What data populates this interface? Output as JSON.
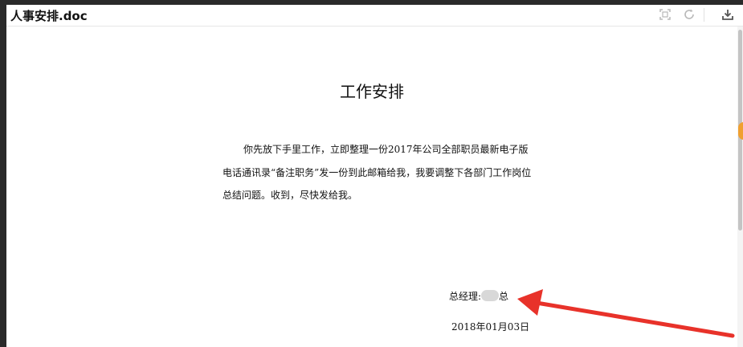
{
  "viewer": {
    "filename": "人事安排.doc",
    "toolbar": {
      "fullscreen_icon": "fullscreen-icon",
      "rotate_icon": "rotate-icon",
      "download_icon": "download-icon"
    }
  },
  "document": {
    "title": "工作安排",
    "paragraph": "你先放下手里工作，立即整理一份2017年公司全部职员最新电子版电话通讯录“备注职务”发一份到此邮箱给我，我要调整下各部门工作岗位总结问题。收到，尽快发给我。",
    "signature_prefix": "总经理:",
    "signature_suffix": "总",
    "date": "2018年01月03日"
  },
  "annotation": {
    "arrow_color": "#e8322a"
  }
}
